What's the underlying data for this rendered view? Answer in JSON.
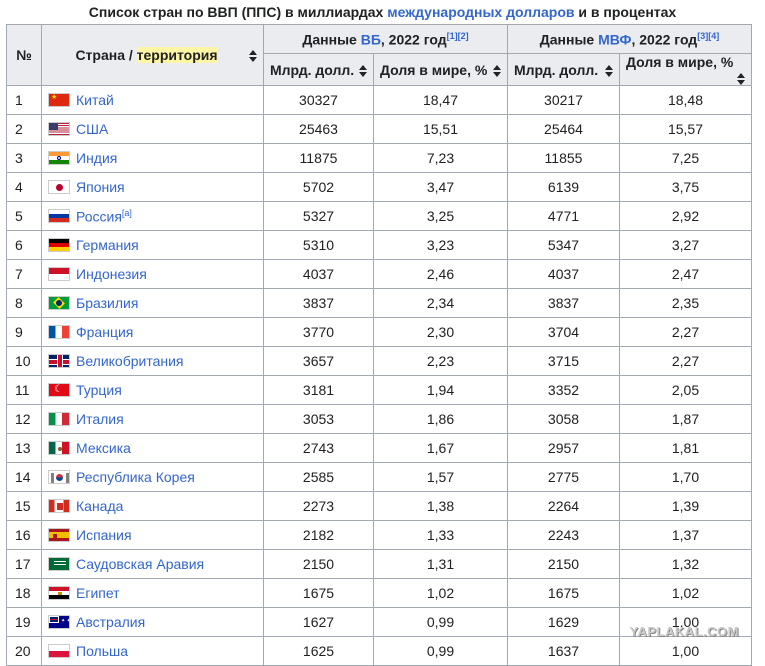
{
  "caption": {
    "prefix": "Список стран по ВВП (ППС) в миллиардах ",
    "link": "международных долларов",
    "suffix": " и в процентах"
  },
  "header": {
    "index": "№",
    "country_prefix": "Страна / ",
    "country_highlight": "территория",
    "wb_prefix": "Данные ",
    "wb_link": "ВБ",
    "wb_suffix": ", 2022 год",
    "wb_refs": "[1][2]",
    "imf_prefix": "Данные ",
    "imf_link": "МВФ",
    "imf_suffix": ", 2022 год",
    "imf_refs": "[3][4]",
    "bln": "Млрд. долл.",
    "share": "Доля в мире, %"
  },
  "rows": [
    {
      "n": "1",
      "flag": "cn",
      "country": "Китай",
      "note": "",
      "wb_bln": "30327",
      "wb_share": "18,47",
      "imf_bln": "30217",
      "imf_share": "18,48"
    },
    {
      "n": "2",
      "flag": "us",
      "country": "США",
      "note": "",
      "wb_bln": "25463",
      "wb_share": "15,51",
      "imf_bln": "25464",
      "imf_share": "15,57"
    },
    {
      "n": "3",
      "flag": "in",
      "country": "Индия",
      "note": "",
      "wb_bln": "11875",
      "wb_share": "7,23",
      "imf_bln": "11855",
      "imf_share": "7,25"
    },
    {
      "n": "4",
      "flag": "jp",
      "country": "Япония",
      "note": "",
      "wb_bln": "5702",
      "wb_share": "3,47",
      "imf_bln": "6139",
      "imf_share": "3,75"
    },
    {
      "n": "5",
      "flag": "ru",
      "country": "Россия",
      "note": "[a]",
      "wb_bln": "5327",
      "wb_share": "3,25",
      "imf_bln": "4771",
      "imf_share": "2,92"
    },
    {
      "n": "6",
      "flag": "de",
      "country": "Германия",
      "note": "",
      "wb_bln": "5310",
      "wb_share": "3,23",
      "imf_bln": "5347",
      "imf_share": "3,27"
    },
    {
      "n": "7",
      "flag": "id",
      "country": "Индонезия",
      "note": "",
      "wb_bln": "4037",
      "wb_share": "2,46",
      "imf_bln": "4037",
      "imf_share": "2,47"
    },
    {
      "n": "8",
      "flag": "br",
      "country": "Бразилия",
      "note": "",
      "wb_bln": "3837",
      "wb_share": "2,34",
      "imf_bln": "3837",
      "imf_share": "2,35"
    },
    {
      "n": "9",
      "flag": "fr",
      "country": "Франция",
      "note": "",
      "wb_bln": "3770",
      "wb_share": "2,30",
      "imf_bln": "3704",
      "imf_share": "2,27"
    },
    {
      "n": "10",
      "flag": "gb",
      "country": "Великобритания",
      "note": "",
      "wb_bln": "3657",
      "wb_share": "2,23",
      "imf_bln": "3715",
      "imf_share": "2,27"
    },
    {
      "n": "11",
      "flag": "tr",
      "country": "Турция",
      "note": "",
      "wb_bln": "3181",
      "wb_share": "1,94",
      "imf_bln": "3352",
      "imf_share": "2,05"
    },
    {
      "n": "12",
      "flag": "it",
      "country": "Италия",
      "note": "",
      "wb_bln": "3053",
      "wb_share": "1,86",
      "imf_bln": "3058",
      "imf_share": "1,87"
    },
    {
      "n": "13",
      "flag": "mx",
      "country": "Мексика",
      "note": "",
      "wb_bln": "2743",
      "wb_share": "1,67",
      "imf_bln": "2957",
      "imf_share": "1,81"
    },
    {
      "n": "14",
      "flag": "kr",
      "country": "Республика Корея",
      "note": "",
      "wb_bln": "2585",
      "wb_share": "1,57",
      "imf_bln": "2775",
      "imf_share": "1,70"
    },
    {
      "n": "15",
      "flag": "ca",
      "country": "Канада",
      "note": "",
      "wb_bln": "2273",
      "wb_share": "1,38",
      "imf_bln": "2264",
      "imf_share": "1,39"
    },
    {
      "n": "16",
      "flag": "es",
      "country": "Испания",
      "note": "",
      "wb_bln": "2182",
      "wb_share": "1,33",
      "imf_bln": "2243",
      "imf_share": "1,37"
    },
    {
      "n": "17",
      "flag": "sa",
      "country": "Саудовская Аравия",
      "note": "",
      "wb_bln": "2150",
      "wb_share": "1,31",
      "imf_bln": "2150",
      "imf_share": "1,32"
    },
    {
      "n": "18",
      "flag": "eg",
      "country": "Египет",
      "note": "",
      "wb_bln": "1675",
      "wb_share": "1,02",
      "imf_bln": "1675",
      "imf_share": "1,02"
    },
    {
      "n": "19",
      "flag": "au",
      "country": "Австралия",
      "note": "",
      "wb_bln": "1627",
      "wb_share": "0,99",
      "imf_bln": "1629",
      "imf_share": "1,00"
    },
    {
      "n": "20",
      "flag": "pl",
      "country": "Польша",
      "note": "",
      "wb_bln": "1625",
      "wb_share": "0,99",
      "imf_bln": "1637",
      "imf_share": "1,00"
    }
  ],
  "watermark": "YAPLAKAL.COM",
  "colors": {
    "link": "#3366cc",
    "header_bg": "#eaecf0",
    "border": "#a2a9b1",
    "highlight": "#fef6a5"
  }
}
